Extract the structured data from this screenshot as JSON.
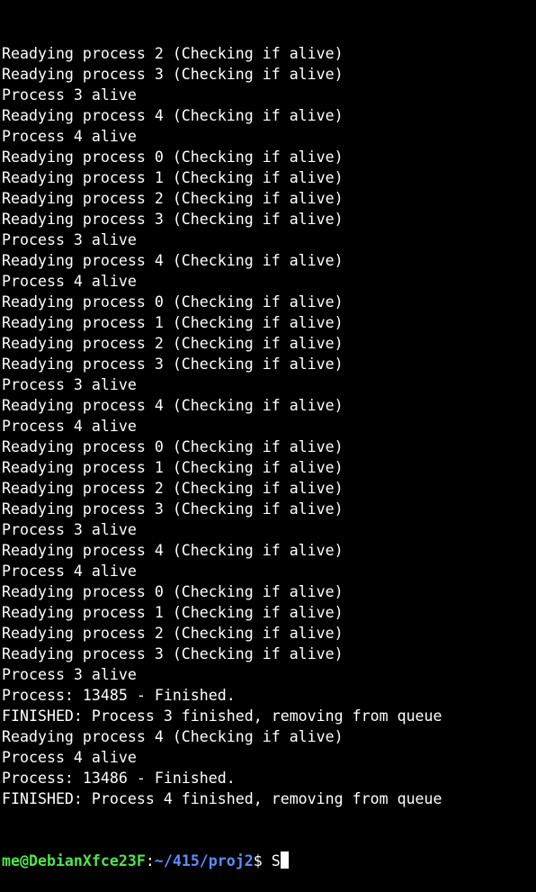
{
  "colors": {
    "background": "#000000",
    "text": "#ffffff",
    "prompt_user": "#4ce64c",
    "prompt_path": "#5c8cff"
  },
  "terminal": {
    "lines": [
      "Readying process 2 (Checking if alive)",
      "Readying process 3 (Checking if alive)",
      "Process 3 alive",
      "Readying process 4 (Checking if alive)",
      "Process 4 alive",
      "Readying process 0 (Checking if alive)",
      "Readying process 1 (Checking if alive)",
      "Readying process 2 (Checking if alive)",
      "Readying process 3 (Checking if alive)",
      "Process 3 alive",
      "Readying process 4 (Checking if alive)",
      "Process 4 alive",
      "Readying process 0 (Checking if alive)",
      "Readying process 1 (Checking if alive)",
      "Readying process 2 (Checking if alive)",
      "Readying process 3 (Checking if alive)",
      "Process 3 alive",
      "Readying process 4 (Checking if alive)",
      "Process 4 alive",
      "Readying process 0 (Checking if alive)",
      "Readying process 1 (Checking if alive)",
      "Readying process 2 (Checking if alive)",
      "Readying process 3 (Checking if alive)",
      "Process 3 alive",
      "Readying process 4 (Checking if alive)",
      "Process 4 alive",
      "Readying process 0 (Checking if alive)",
      "Readying process 1 (Checking if alive)",
      "Readying process 2 (Checking if alive)",
      "Readying process 3 (Checking if alive)",
      "Process 3 alive",
      "Process: 13485 - Finished.",
      "FINISHED: Process 3 finished, removing from queue",
      "Readying process 4 (Checking if alive)",
      "Process 4 alive",
      "Process: 13486 - Finished.",
      "FINISHED: Process 4 finished, removing from queue"
    ],
    "prompt": {
      "user_host": "me@DebianXfce23F",
      "colon": ":",
      "path": "~/415/proj2",
      "dollar": "$",
      "typed": " S"
    }
  }
}
